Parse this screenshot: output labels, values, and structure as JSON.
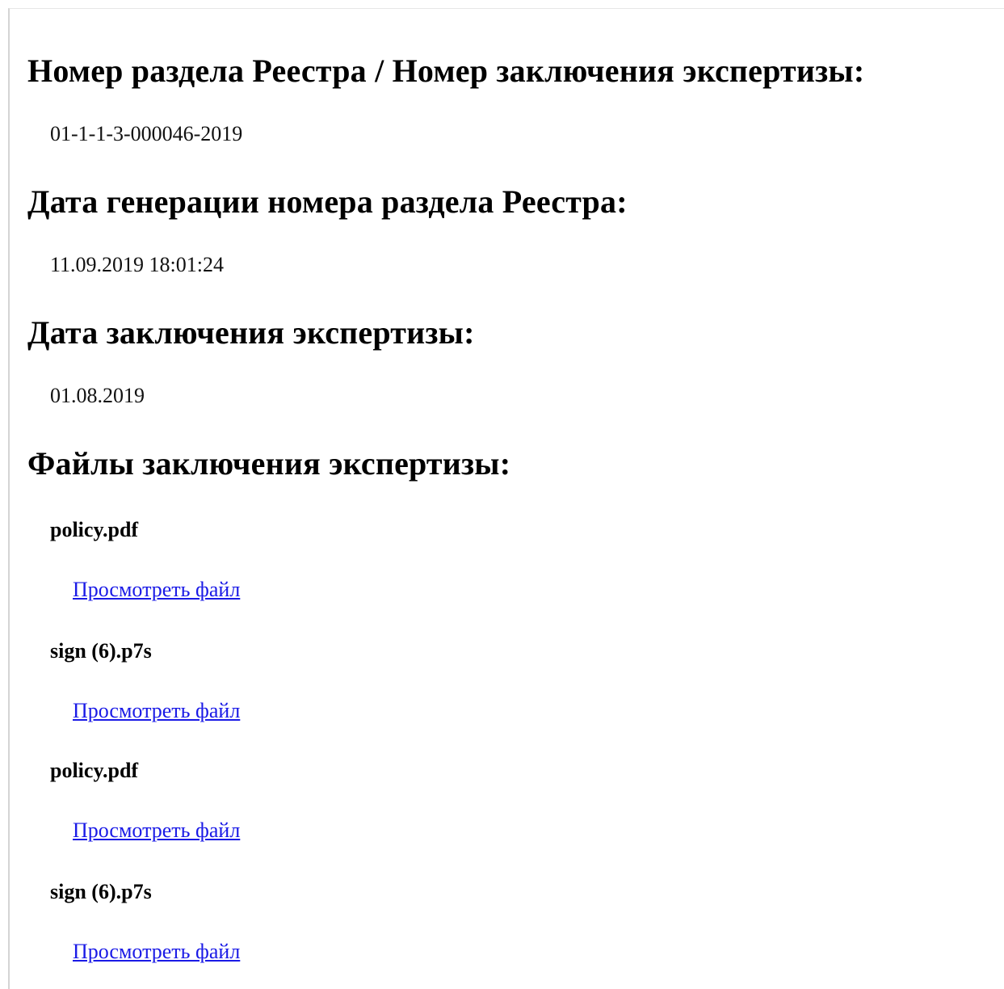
{
  "sections": {
    "registry_number": {
      "heading": "Номер раздела Реестра / Номер заключения экспертизы:",
      "value": "01-1-1-3-000046-2019"
    },
    "generation_date": {
      "heading": "Дата генерации номера раздела Реестра:",
      "value": "11.09.2019 18:01:24"
    },
    "conclusion_date": {
      "heading": "Дата заключения экспертизы:",
      "value": "01.08.2019"
    },
    "files": {
      "heading": "Файлы заключения экспертизы:",
      "items": [
        {
          "name": "policy.pdf",
          "link_label": "Просмотреть файл"
        },
        {
          "name": "sign (6).p7s",
          "link_label": "Просмотреть файл"
        },
        {
          "name": "policy.pdf",
          "link_label": "Просмотреть файл"
        },
        {
          "name": "sign (6).p7s",
          "link_label": "Просмотреть файл"
        }
      ]
    }
  },
  "colors": {
    "link": "#1a1ae6",
    "text": "#000000",
    "background": "#ffffff"
  }
}
